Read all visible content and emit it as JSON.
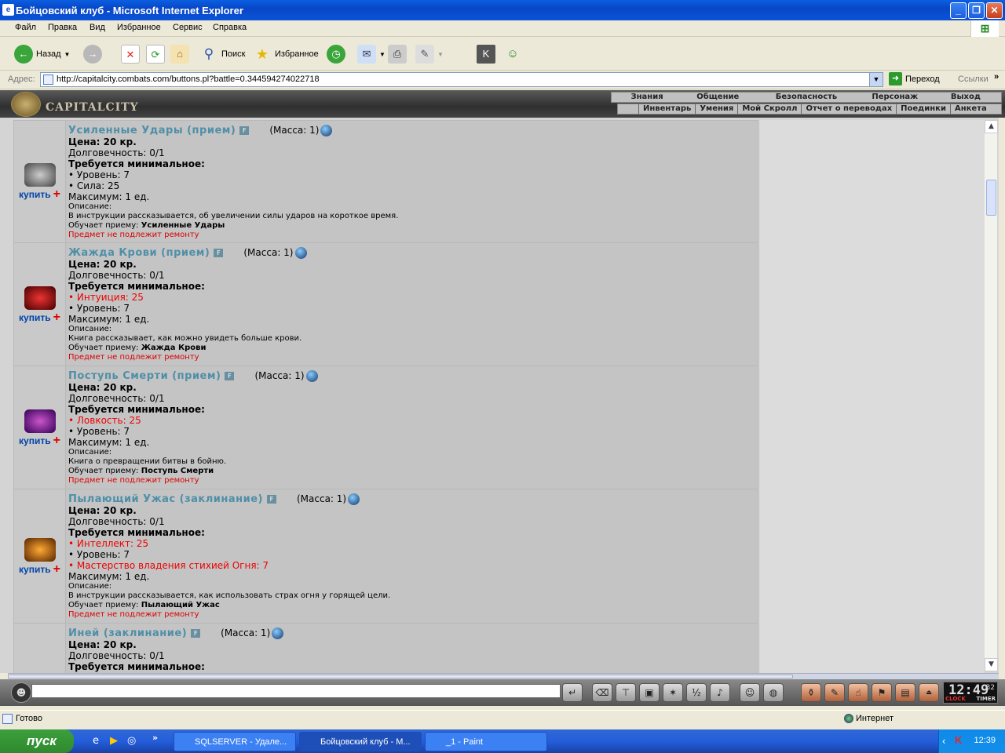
{
  "window": {
    "title": "Бойцовский клуб - Microsoft Internet Explorer"
  },
  "menu": [
    "Файл",
    "Правка",
    "Вид",
    "Избранное",
    "Сервис",
    "Справка"
  ],
  "toolbar": {
    "back": "Назад",
    "search": "Поиск",
    "favorites": "Избранное"
  },
  "address": {
    "label": "Адрес:",
    "url": "http://capitalcity.combats.com/buttons.pl?battle=0.344594274022718",
    "go": "Переход",
    "links": "Ссылки"
  },
  "game": {
    "logo": "CAPITALCITY",
    "menu1": [
      "Знания",
      "Общение",
      "Безопасность",
      "Персонаж",
      "Выход"
    ],
    "menu2": [
      "Инвентарь",
      "Умения",
      "Мой Скролл",
      "Отчет о переводах",
      "Поединки",
      "Анкета"
    ]
  },
  "labels": {
    "buy": "купить",
    "price": "Цена: 20 кр.",
    "durability": "Долговечность: 0/1",
    "req": "Требуется минимальное:",
    "max": "Максимум: 1 ед.",
    "desc": "Описание:",
    "teaches": "Обучает приему:",
    "norepair": "Предмет не подлежит ремонту",
    "mass": "(Масса: 1)",
    "f": "F"
  },
  "items": [
    {
      "name": "Усиленные Удары (прием)",
      "color": "#888888",
      "reqs": [
        {
          "text": "• Уровень: 7",
          "red": false
        },
        {
          "text": "• Сила: 25",
          "red": false
        }
      ],
      "description": "В инструкции рассказывается, об увеличении силы ударов на короткое время.",
      "skill": "Усиленные Удары"
    },
    {
      "name": "Жажда Крови (прием)",
      "color": "#b01818",
      "reqs": [
        {
          "text": "• Интуиция: 25",
          "red": true
        },
        {
          "text": "• Уровень: 7",
          "red": false
        }
      ],
      "description": "Книга рассказывает, как можно увидеть больше крови.",
      "skill": "Жажда Крови"
    },
    {
      "name": "Поступь Смерти (прием)",
      "color": "#7a1f9a",
      "reqs": [
        {
          "text": "• Ловкость: 25",
          "red": true
        },
        {
          "text": "• Уровень: 7",
          "red": false
        }
      ],
      "description": "Книга о превращении битвы в бойню.",
      "skill": "Поступь Смерти"
    },
    {
      "name": "Пылающий Ужас (заклинание)",
      "color": "#c06010",
      "reqs": [
        {
          "text": "• Интеллект: 25",
          "red": true
        },
        {
          "text": "• Уровень: 7",
          "red": false
        },
        {
          "text": "• Мастерство владения стихией Огня: 7",
          "red": true
        }
      ],
      "description": "В инструкции рассказывается, как использовать страх огня у горящей цели.",
      "skill": "Пылающий Ужас"
    }
  ],
  "partial_item": {
    "name": "Иней (заклинание)"
  },
  "clock": {
    "time": "12:49",
    "sec": "32",
    "clock_label": "CLOCK",
    "timer_label": "TIMER"
  },
  "status": {
    "text": "Готово",
    "zone": "Интернет"
  },
  "taskbar": {
    "start": "пуск",
    "tasks": [
      "SQLSERVER - Удале...",
      "Бойцовский клуб - М...",
      "_1 - Paint"
    ],
    "time": "12:39"
  }
}
